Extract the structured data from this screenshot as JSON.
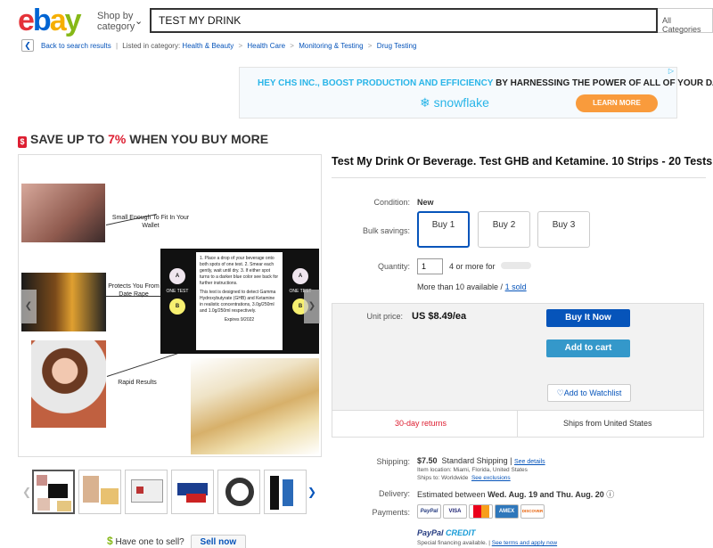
{
  "header": {
    "logo": {
      "e": "e",
      "b": "b",
      "a": "a",
      "y": "y"
    },
    "shop_by_line1": "Shop by",
    "shop_by_line2": "category",
    "search_value": "TEST MY DRINK",
    "category_select": "All Categories"
  },
  "breadcrumb": {
    "back_label": "Back to search results",
    "listed_label": "Listed in category:",
    "items": [
      "Health & Beauty",
      "Health Care",
      "Monitoring & Testing",
      "Drug Testing"
    ]
  },
  "ad": {
    "text_prefix": "HEY CHS INC., BOOST PRODUCTION AND EFFICIENCY",
    "text_suffix": "BY HARNESSING THE POWER OF ALL OF YOUR DATA",
    "brand": "snowflake",
    "cta": "LEARN MORE"
  },
  "promo": {
    "prefix": "SAVE UP TO",
    "percent": "7%",
    "suffix": "WHEN YOU BUY MORE"
  },
  "image": {
    "caption1": "Small Enough To Fit In Your Wallet",
    "caption2": "Protects You From Date Rape",
    "caption3": "Rapid Results",
    "card_text": "1. Place a drop of your beverage onto both spots of one test. 2. Smear each gently, wait until dry. 3. If either spot turns to a darker blue color see back for further instructions.",
    "card_note": "This test is designed to detect Gamma Hydroxybutyrate (GHB) and Ketamine in realistic concentrations, 3.0g/250ml and 1.0g/250ml respectively.",
    "card_expires": "Expires 9/2022",
    "card_one_test": "ONE TEST",
    "dot_a": "A",
    "dot_b": "B"
  },
  "sell": {
    "text": "Have one to sell?",
    "button": "Sell now"
  },
  "product": {
    "title": "Test My Drink Or Beverage. Test GHB and Ketamine. 10 Strips - 20 Tests.",
    "condition_label": "Condition:",
    "condition_value": "New",
    "bulk_label": "Bulk savings:",
    "bulk_options": [
      "Buy 1",
      "Buy 2",
      "Buy 3"
    ],
    "quantity_label": "Quantity:",
    "quantity_value": "1",
    "quantity_suffix": "4 or more for",
    "availability": "More than 10 available /",
    "sold": "1 sold",
    "unit_price_label": "Unit price:",
    "unit_price": "US $8.49/ea",
    "buy_now": "Buy It Now",
    "add_to_cart": "Add to cart",
    "add_to_watchlist": "Add to Watchlist",
    "returns": "30-day returns",
    "ships_from": "Ships from United States"
  },
  "shipping": {
    "label": "Shipping:",
    "cost": "$7.50",
    "method": "Standard Shipping |",
    "details_link": "See details",
    "location": "Item location:  Miami, Florida, United States",
    "ships_to": "Ships to:  Worldwide",
    "exclusions_link": "See exclusions"
  },
  "delivery": {
    "label": "Delivery:",
    "prefix": "Estimated between",
    "dates": "Wed. Aug. 19 and Thu. Aug. 20"
  },
  "payments": {
    "label": "Payments:",
    "methods": [
      "PayPal",
      "VISA",
      "MC",
      "AMEX",
      "DISCOVER"
    ],
    "credit_brand": "PayPal",
    "credit_word": "CREDIT",
    "credit_text": "Special financing available.",
    "credit_link": "See terms and apply now"
  },
  "colors": {
    "ebay_red": "#e53238",
    "ebay_blue": "#0064d2",
    "ebay_yellow": "#f5af02",
    "ebay_green": "#86b817",
    "buy_button": "#0654ba",
    "cart_button": "#3498ca"
  }
}
